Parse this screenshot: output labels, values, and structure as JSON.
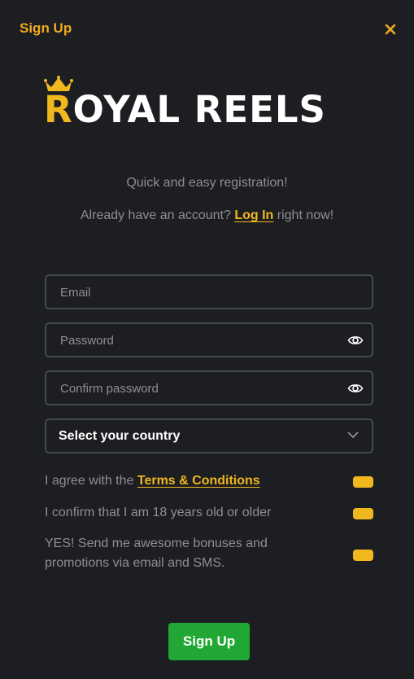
{
  "header": {
    "title": "Sign Up"
  },
  "logo": {
    "first_letter": "R",
    "rest": "OYAL REELS",
    "brand_color": "#f0b71f"
  },
  "intro": {
    "subtitle": "Quick and easy registration!",
    "account_prefix": "Already have an account?",
    "login_link": "Log In",
    "account_suffix": "right now!"
  },
  "form": {
    "email_placeholder": "Email",
    "password_placeholder": "Password",
    "confirm_placeholder": "Confirm password",
    "country_label": "Select your country"
  },
  "checks": {
    "terms_prefix": "I agree with the",
    "terms_link": "Terms & Conditions",
    "age": "I confirm that I am 18 years old or older",
    "promo": "YES! Send me awesome bonuses and promotions via email and SMS."
  },
  "submit_label": "Sign Up",
  "icons": {
    "close": "close-icon",
    "eye": "eye-icon",
    "chevron": "chevron-down-icon",
    "crown": "crown-icon"
  }
}
